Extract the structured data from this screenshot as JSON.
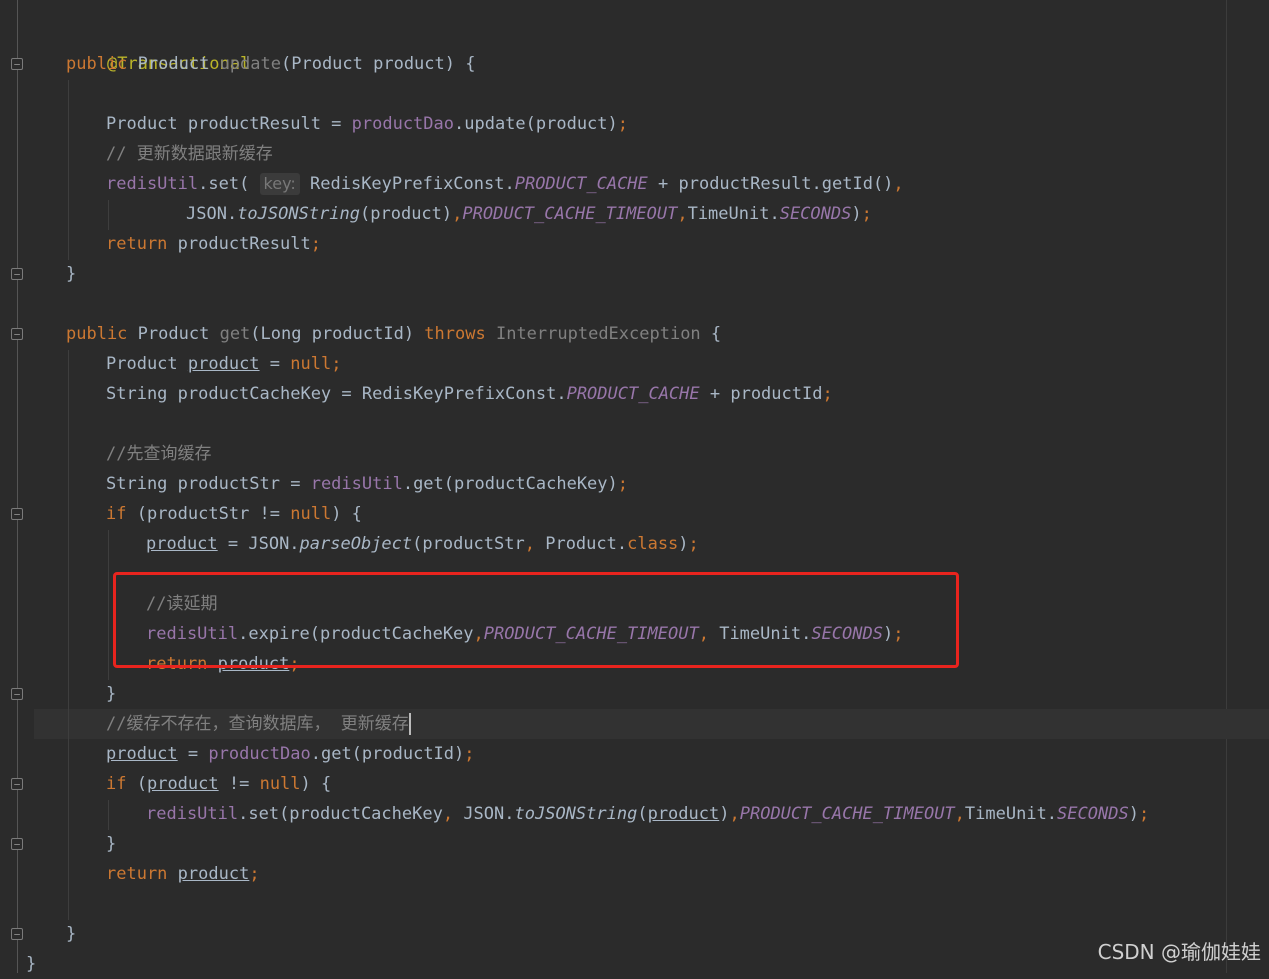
{
  "code": {
    "annotation": "@Transactional",
    "update_method": {
      "modifier": "public",
      "return_type": "Product",
      "name": "update",
      "params": "(Product product) {"
    },
    "update_body": {
      "l1_a": "Product productResult = ",
      "l1_field": "productDao",
      "l1_b": ".update(product)",
      "comment_update": "// 更新数据跟新缓存",
      "l3_field": "redisUtil",
      "l3_a": ".set( ",
      "hint_key": "key:",
      "l3_b": " RedisKeyPrefixConst.",
      "l3_const": "PRODUCT_CACHE",
      "l3_c": " + productResult.getId()",
      "l4_a": "JSON.",
      "l4_method": "toJSONString",
      "l4_b": "(product)",
      "l4_const1": "PRODUCT_CACHE_TIMEOUT",
      "l4_c": "TimeUnit.",
      "l4_const2": "SECONDS",
      "l4_d": ")",
      "l5_kw": "return",
      "l5_a": " productResult"
    },
    "get_method": {
      "modifier": "public",
      "return_type": "Product",
      "name": "get",
      "params": "(Long productId) ",
      "throws_kw": "throws",
      "exception": "InterruptedException",
      "open": " {"
    },
    "get_body": {
      "l1_a": "Product ",
      "l1_var": "product",
      "l1_b": " = ",
      "l1_null": "null",
      "l2_a": "String productCacheKey = RedisKeyPrefixConst.",
      "l2_const": "PRODUCT_CACHE",
      "l2_b": " + productId",
      "comment_query": "//先查询缓存",
      "l4_a": "String productStr = ",
      "l4_field": "redisUtil",
      "l4_b": ".get(productCacheKey)",
      "l5_kw": "if",
      "l5_a": " (productStr != ",
      "l5_null": "null",
      "l5_b": ") {",
      "l6_var": "product",
      "l6_a": " = JSON.",
      "l6_method": "parseObject",
      "l6_b": "(productStr",
      "l6_c": " Product.",
      "l6_class": "class",
      "l6_d": ")",
      "comment_extend": "//读延期",
      "l8_field": "redisUtil",
      "l8_a": ".expire(productCacheKey",
      "l8_const1": "PRODUCT_CACHE_TIMEOUT",
      "l8_b": " TimeUnit.",
      "l8_const2": "SECONDS",
      "l8_c": ")",
      "l9_kw": "return",
      "l9_var": "product",
      "close_if": "}",
      "comment_miss": "//缓存不存在，查询数据库， 更新缓存",
      "l11_var": "product",
      "l11_a": " = ",
      "l11_field": "productDao",
      "l11_b": ".get(productId)",
      "l12_kw": "if",
      "l12_a": " (",
      "l12_var": "product",
      "l12_b": " != ",
      "l12_null": "null",
      "l12_c": ") {",
      "l13_field": "redisUtil",
      "l13_a": ".set(productCacheKey",
      "l13_b": " JSON.",
      "l13_method": "toJSONString",
      "l13_c": "(",
      "l13_var": "product",
      "l13_d": ")",
      "l13_const1": "PRODUCT_CACHE_TIMEOUT",
      "l13_e": "TimeUnit.",
      "l13_const2": "SECONDS",
      "l13_f": ")",
      "close_if2": "}",
      "l15_kw": "return",
      "l15_var": "product"
    },
    "punct": {
      "semicolon": ";",
      "comma": ",",
      "close_brace": "}"
    }
  },
  "watermark": "CSDN @瑜伽娃娃",
  "colors": {
    "background": "#2b2b2b",
    "keyword": "#cc7832",
    "annotation": "#bbb529",
    "field": "#9876aa",
    "comment": "#808080",
    "text": "#a9b7c6",
    "highlight_box": "#e8241e"
  }
}
